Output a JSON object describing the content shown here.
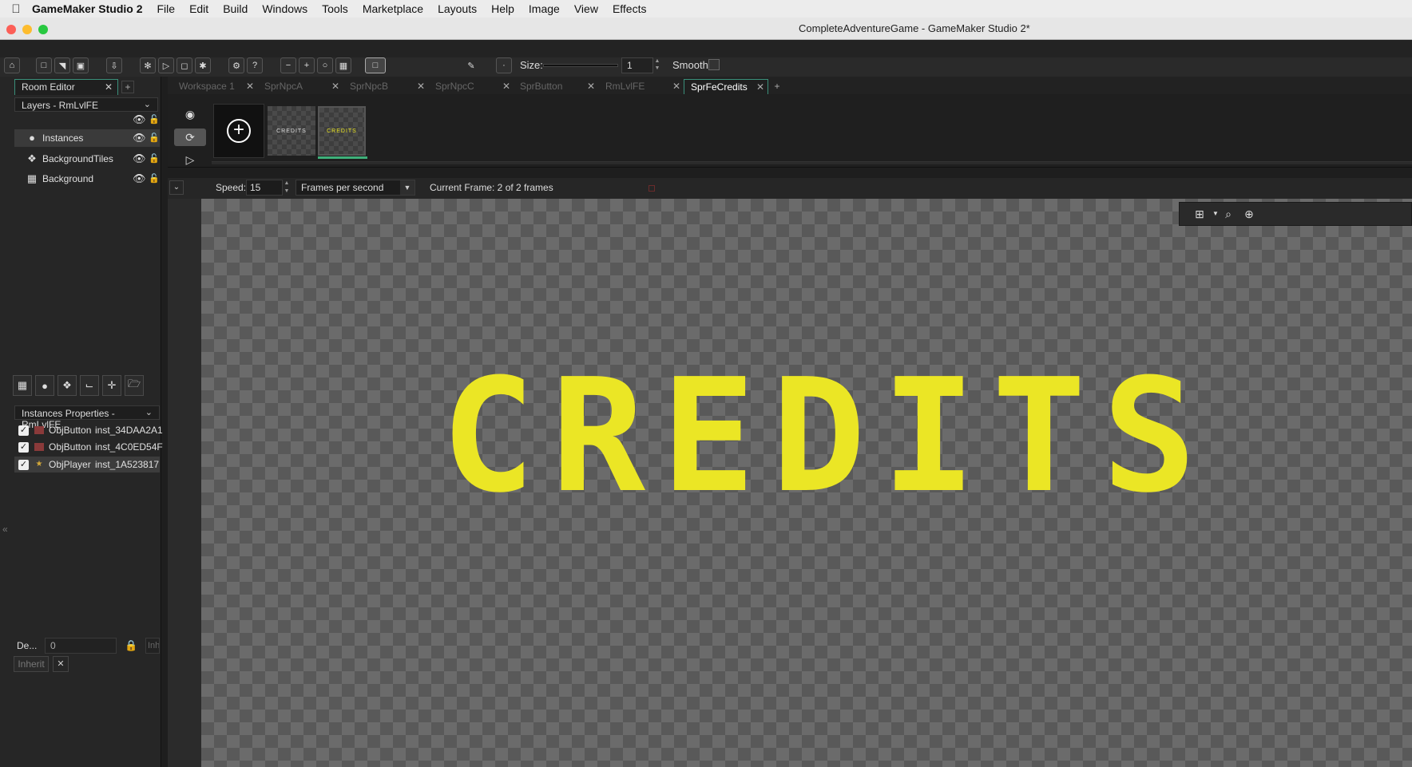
{
  "menubar": {
    "app_name": "GameMaker Studio 2",
    "items": [
      "File",
      "Edit",
      "Build",
      "Windows",
      "Tools",
      "Marketplace",
      "Layouts",
      "Help",
      "Image",
      "View",
      "Effects"
    ]
  },
  "window": {
    "title": "CompleteAdventureGame - GameMaker Studio 2*"
  },
  "toolbar": {
    "size_label": "Size:",
    "size_value": "1",
    "smooth_label": "Smooth"
  },
  "left_panel": {
    "tab_label": "Room Editor",
    "layers_dropdown": "Layers - RmLvlFE",
    "layers": [
      {
        "name": "Instances",
        "icon": "instances-icon"
      },
      {
        "name": "BackgroundTiles",
        "icon": "tiles-icon"
      },
      {
        "name": "Background",
        "icon": "background-icon"
      }
    ],
    "instances_dropdown": "Instances Properties - RmLvlFE",
    "instances": [
      {
        "object": "ObjButton",
        "id": "inst_34DAA2A1",
        "checked": true
      },
      {
        "object": "ObjButton",
        "id": "inst_4C0ED54F",
        "checked": true
      },
      {
        "object": "ObjPlayer",
        "id": "inst_1A523817",
        "checked": true
      }
    ],
    "depth_label": "De...",
    "depth_value": "0",
    "inherit_field": "Inh",
    "inherit_button": "Inherit"
  },
  "doc_tabs": {
    "tabs": [
      "Workspace 1",
      "SprNpcA",
      "SprNpcB",
      "SprNpcC",
      "SprButton",
      "RmLvlFE",
      "SprFeCredits"
    ],
    "active": "SprFeCredits",
    "add_label": "+"
  },
  "frames": {
    "thumb_labels": [
      "CREDITS",
      "CREDITS"
    ]
  },
  "playback": {
    "speed_label": "Speed:",
    "speed_value": "15",
    "units": "Frames per second",
    "current_frame": "Current Frame: 2 of 2 frames"
  },
  "canvas": {
    "sprite_text": "CREDITS",
    "text_color": "#EBE625"
  }
}
